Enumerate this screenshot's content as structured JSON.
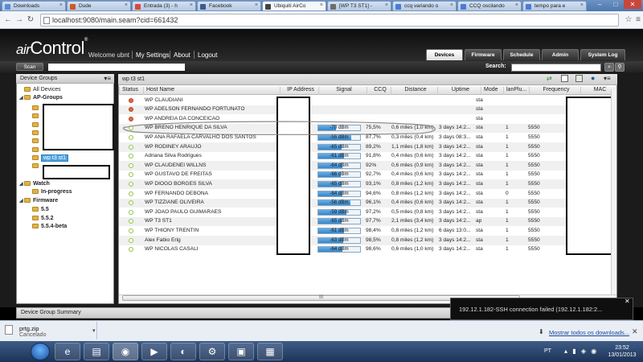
{
  "browser": {
    "tabs": [
      {
        "label": "Downloads",
        "color": "#5b8bd5",
        "active": false
      },
      {
        "label": "Dude",
        "color": "#cc5a2a",
        "active": false
      },
      {
        "label": "Entrada (3) - h",
        "color": "#d64b3a",
        "active": false
      },
      {
        "label": "Facebook",
        "color": "#3b5998",
        "active": false
      },
      {
        "label": "Ubiquiti AirCo",
        "color": "#444444",
        "active": true
      },
      {
        "label": "[WP T3 ST1] -",
        "color": "#6d6d6d",
        "active": false
      },
      {
        "label": "ccq variando o",
        "color": "#4a7cd5",
        "active": false
      },
      {
        "label": "CCQ oscilando",
        "color": "#4a7cd5",
        "active": false
      },
      {
        "label": "tempo para e",
        "color": "#4a7cd5",
        "active": false
      }
    ],
    "url": "localhost:9080/main.seam?cid=661432"
  },
  "app": {
    "logo_prefix": "air",
    "logo_main": "Control",
    "logo_mark": "®",
    "welcome": "Welcome ubnt",
    "links": [
      "My Settings",
      "About",
      "Logout"
    ],
    "nav_tabs": [
      {
        "label": "Devices",
        "active": true
      },
      {
        "label": "Firmware",
        "active": false
      },
      {
        "label": "Schedule",
        "active": false
      },
      {
        "label": "Admin",
        "active": false
      },
      {
        "label": "System Log",
        "active": false
      }
    ],
    "scan_label": "Scan",
    "search_label": "Search:"
  },
  "left_panel": {
    "title": "Device Groups",
    "all_devices": "All Devices",
    "ap_groups": "AP-Groups",
    "selected_group": "wp t3 st1",
    "watch": "Watch",
    "in_progress": "In-progress",
    "firmware": "Firmware",
    "firmware_versions": [
      "5.5",
      "5.5.2",
      "5.5.4-beta"
    ]
  },
  "main_panel": {
    "title": "wp t3 st1",
    "columns": [
      "Status",
      "Host Name",
      "IP Address",
      "Signal",
      "CCQ",
      "Distance",
      "Uptime",
      "Mode",
      "lanPlu...",
      "Frequency",
      "MAC"
    ],
    "rows": [
      {
        "status": "red",
        "host": "WP CLAUDIANI",
        "signal": "",
        "signal_level": 0,
        "ccq": "",
        "distance": "",
        "uptime": "",
        "mode": "sta",
        "lan": "",
        "freq": ""
      },
      {
        "status": "red",
        "host": "WP ADELSON FERNANDO FORTUNATO",
        "signal": "",
        "signal_level": 0,
        "ccq": "",
        "distance": "",
        "uptime": "",
        "mode": "sta",
        "lan": "",
        "freq": ""
      },
      {
        "status": "red",
        "host": "WP ANDREIA DA CONCEICAO",
        "signal": "",
        "signal_level": 0,
        "ccq": "",
        "distance": "",
        "uptime": "",
        "mode": "sta",
        "lan": "",
        "freq": ""
      },
      {
        "status": "green",
        "host": "WP BRENO HENRIQUE DA SILVA",
        "signal": "-70 dBm",
        "signal_level": 0.42,
        "ccq": "75,5%",
        "distance": "0,6 miles (1,0 km)",
        "uptime": "3 days 14:2...",
        "mode": "sta",
        "lan": "1",
        "freq": "5550"
      },
      {
        "status": "green",
        "host": "WP ANA RAFAELA CARVALHO DOS SANTOS",
        "signal": "-55 dBm",
        "signal_level": 0.78,
        "ccq": "87,7%",
        "distance": "0,3 miles (0,4 km)",
        "uptime": "3 days 08:3...",
        "mode": "sta",
        "lan": "1",
        "freq": "5550"
      },
      {
        "status": "green",
        "host": "WP RODINEY ARAUJO",
        "signal": "-65 dBm",
        "signal_level": 0.55,
        "ccq": "89,2%",
        "distance": "1,1 miles (1,8 km)",
        "uptime": "3 days 14:2...",
        "mode": "sta",
        "lan": "1",
        "freq": "5550"
      },
      {
        "status": "green",
        "host": "Adriana Silva Rodrigues",
        "signal": "-61 dBm",
        "signal_level": 0.62,
        "ccq": "91,8%",
        "distance": "0,4 miles (0,6 km)",
        "uptime": "3 days 14:2...",
        "mode": "sta",
        "lan": "1",
        "freq": "5550"
      },
      {
        "status": "green",
        "host": "WP CLAUDENEI WILLNS",
        "signal": "-64 dBm",
        "signal_level": 0.57,
        "ccq": "92%",
        "distance": "0,6 miles (0,9 km)",
        "uptime": "3 days 14:2...",
        "mode": "sta",
        "lan": "1",
        "freq": "5550"
      },
      {
        "status": "green",
        "host": "WP GUSTAVO DE FREITAS",
        "signal": "-66 dBm",
        "signal_level": 0.53,
        "ccq": "92,7%",
        "distance": "0,4 miles (0,6 km)",
        "uptime": "3 days 14:2...",
        "mode": "sta",
        "lan": "1",
        "freq": "5550"
      },
      {
        "status": "green",
        "host": "WP DIOGO BORGES SILVA",
        "signal": "-65 dBm",
        "signal_level": 0.55,
        "ccq": "93,1%",
        "distance": "0,8 miles (1,2 km)",
        "uptime": "3 days 14:2...",
        "mode": "sta",
        "lan": "1",
        "freq": "5550"
      },
      {
        "status": "green",
        "host": "WP FERNANDO DEBONA",
        "signal": "-64 dBm",
        "signal_level": 0.57,
        "ccq": "94,6%",
        "distance": "0,8 miles (1,2 km)",
        "uptime": "3 days 14:2...",
        "mode": "sta",
        "lan": "0",
        "freq": "5550"
      },
      {
        "status": "green",
        "host": "WP TIZZIANE OLIVEIRA",
        "signal": "-56 dBm",
        "signal_level": 0.76,
        "ccq": "96,1%",
        "distance": "0,4 miles (0,6 km)",
        "uptime": "3 days 14:2...",
        "mode": "sta",
        "lan": "1",
        "freq": "5550"
      },
      {
        "status": "green",
        "host": "WP JOAO PAULO GUIMARAES",
        "signal": "-59 dBm",
        "signal_level": 0.68,
        "ccq": "97,2%",
        "distance": "0,5 miles (0,8 km)",
        "uptime": "3 days 14:2...",
        "mode": "sta",
        "lan": "1",
        "freq": "5550"
      },
      {
        "status": "green",
        "host": "WP T3 ST1",
        "signal": "-65 dBm",
        "signal_level": 0.55,
        "ccq": "97,7%",
        "distance": "2,1 miles (3,4 km)",
        "uptime": "3 days 14:2...",
        "mode": "ap",
        "lan": "1",
        "freq": "5550"
      },
      {
        "status": "green",
        "host": "WP THIONY TRENTIN",
        "signal": "-61 dBm",
        "signal_level": 0.62,
        "ccq": "98,4%",
        "distance": "0,8 miles (1,2 km)",
        "uptime": "6 days 13:0...",
        "mode": "sta",
        "lan": "1",
        "freq": "5550"
      },
      {
        "status": "green",
        "host": "Alex Fabio Erig",
        "signal": "-63 dBm",
        "signal_level": 0.59,
        "ccq": "98,5%",
        "distance": "0,8 miles (1,2 km)",
        "uptime": "3 days 14:2...",
        "mode": "sta",
        "lan": "1",
        "freq": "5550"
      },
      {
        "status": "green",
        "host": "WP NICOLAS CASALI",
        "signal": "-64 dBm",
        "signal_level": 0.57,
        "ccq": "98,6%",
        "distance": "0,6 miles (1,0 km)",
        "uptime": "3 days 14:2...",
        "mode": "sta",
        "lan": "1",
        "freq": "5550"
      }
    ],
    "scroll_label": "III"
  },
  "summary": {
    "title": "Device Group Summary"
  },
  "toast": {
    "message": "192.12.1.182-SSH connection failed (192.12.1.182:2..."
  },
  "download": {
    "file": "prtg.zip",
    "status": "Cancelado",
    "show_all": "Mostrar todos os downloads..."
  },
  "taskbar": {
    "lang": "PT",
    "time": "23:52",
    "date": "13/01/2013"
  },
  "colors": {
    "signal_fill": "#3585c9",
    "status_red": "#e06848",
    "status_green": "#8ec641",
    "selected_group": "#4ea3dd"
  }
}
